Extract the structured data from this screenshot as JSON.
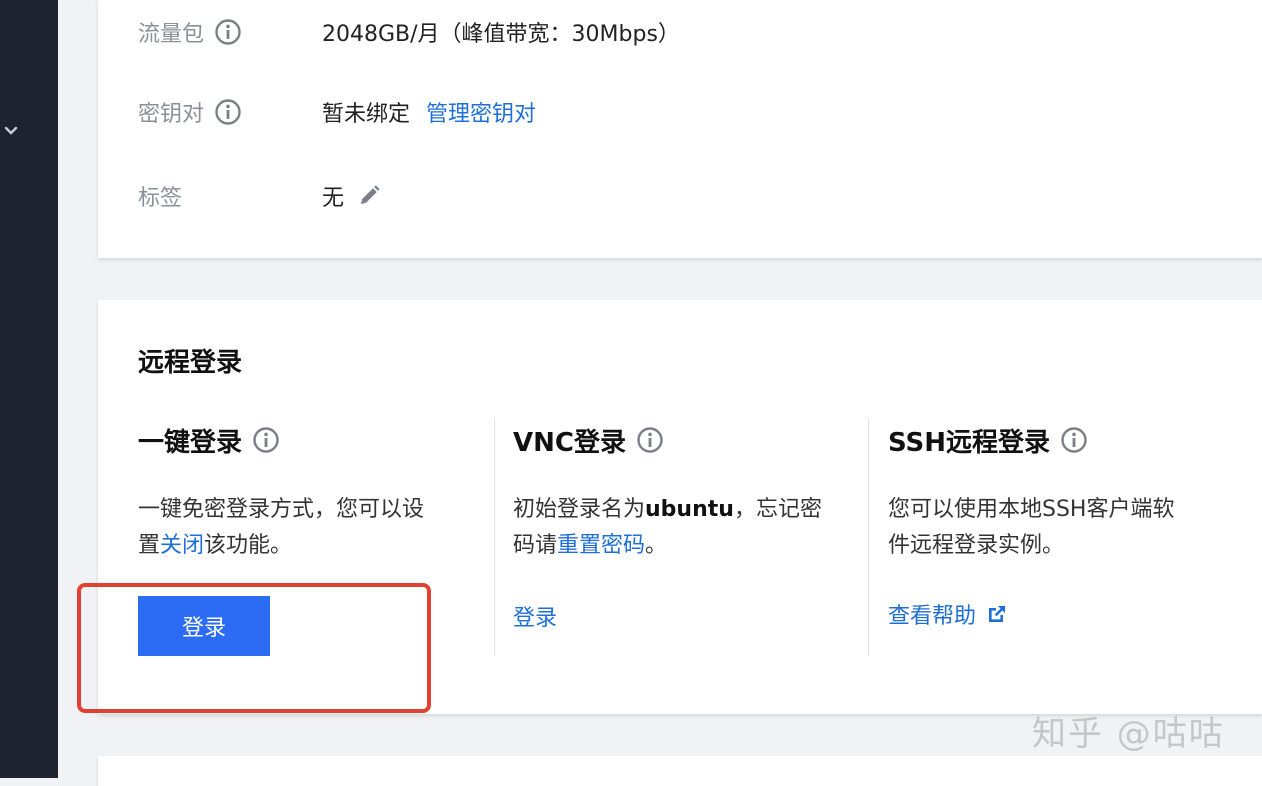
{
  "config": {
    "traffic": {
      "label": "流量包",
      "value": "2048GB/月（峰值带宽：30Mbps）"
    },
    "keypair": {
      "label": "密钥对",
      "value": "暂未绑定",
      "link": "管理密钥对"
    },
    "tags": {
      "label": "标签",
      "value": "无"
    }
  },
  "remote_login": {
    "title": "远程登录",
    "one_click": {
      "title": "一键登录",
      "desc_line1": "一键免密登录方式，您可以设",
      "desc_line2_pre": "置",
      "desc_link": "关闭",
      "desc_line2_post": "该功能。",
      "button": "登录"
    },
    "vnc": {
      "title": "VNC登录",
      "desc_pre": "初始登录名为",
      "desc_bold": "ubuntu",
      "desc_mid": "，忘记密",
      "desc_line2_pre": "码请",
      "desc_link": "重置密码",
      "desc_line2_post": "。",
      "link": "登录"
    },
    "ssh": {
      "title": "SSH远程登录",
      "desc_line1": "您可以使用本地SSH客户端软",
      "desc_line2": "件远程登录实例。",
      "link": "查看帮助"
    }
  },
  "watermark": "知乎 @咕咕",
  "icons": {
    "info": "info-circle-icon",
    "edit": "pencil-icon",
    "external": "external-link-icon",
    "sidebar": "chevron-down-icon"
  },
  "colors": {
    "primary": "#2c6cf5",
    "link": "#1f6fd8",
    "highlight": "#e3402f",
    "sidebar": "#1e2330"
  }
}
